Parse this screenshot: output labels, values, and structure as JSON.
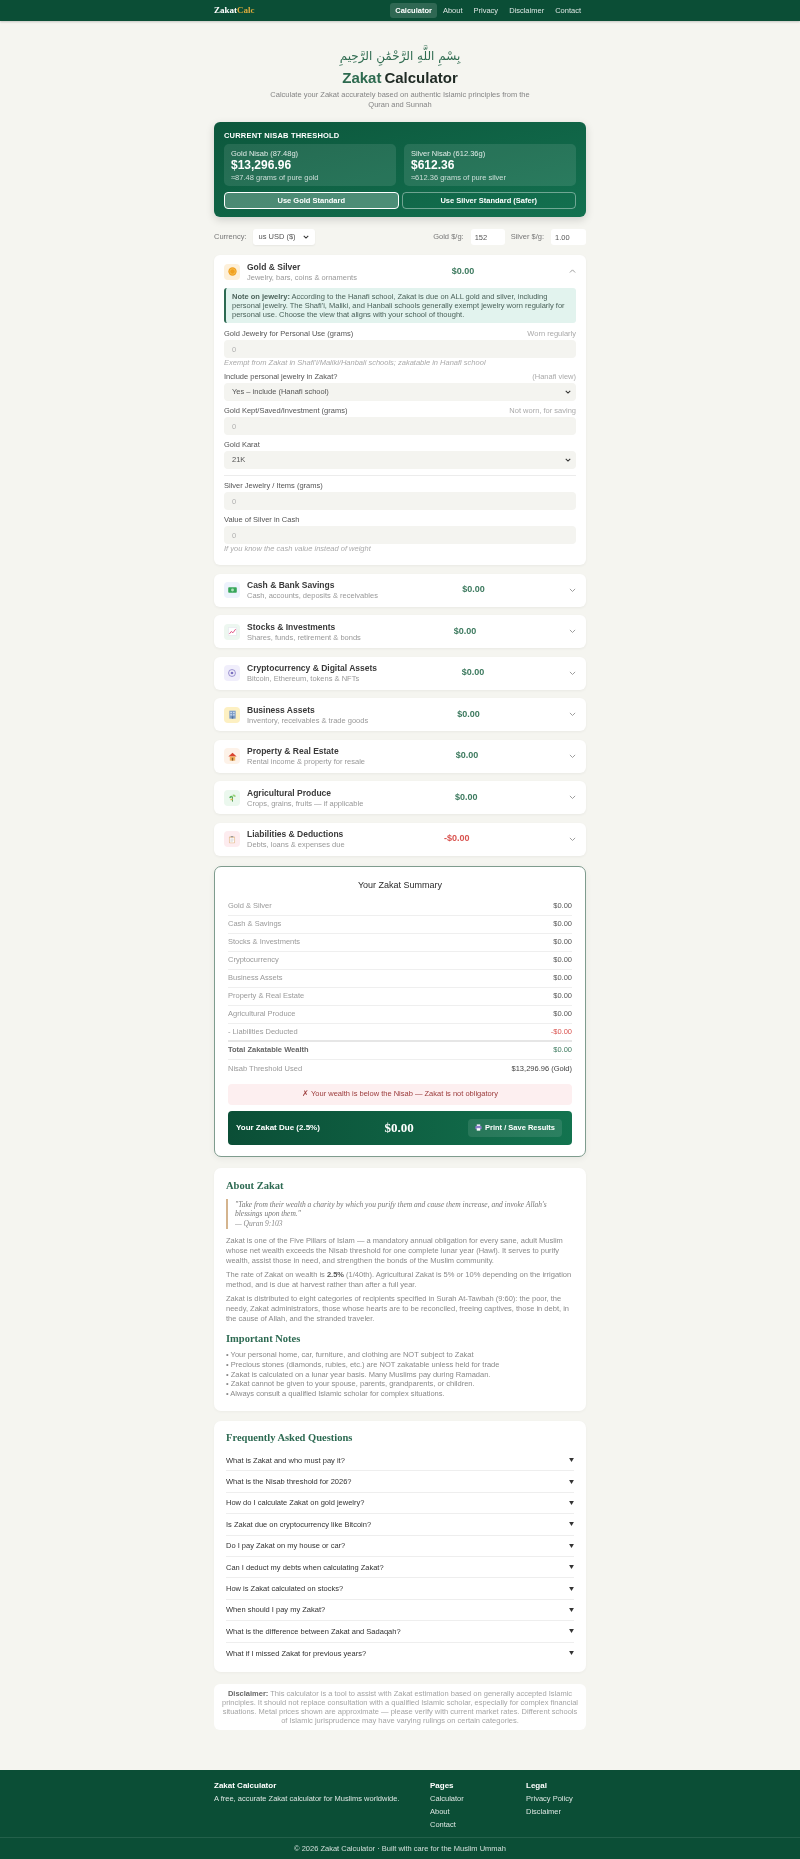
{
  "nav": {
    "logo": {
      "first": "Zakat",
      "second": "Calc"
    },
    "items": [
      {
        "label": "Calculator",
        "selected": true
      },
      {
        "label": "About",
        "selected": false
      },
      {
        "label": "Privacy",
        "selected": false
      },
      {
        "label": "Disclaimer",
        "selected": false
      },
      {
        "label": "Contact",
        "selected": false
      }
    ]
  },
  "header": {
    "bismillah": "بِسْمِ اللَّهِ الرَّحْمَٰنِ الرَّحِيمِ",
    "title_accent": "Zakat",
    "title_rest": "Calculator",
    "subtitle": "Calculate your Zakat accurately based on authentic Islamic principles from the Quran and Sunnah"
  },
  "nisab": {
    "title": "CURRENT NISAB THRESHOLD",
    "standards": [
      {
        "label": "Gold Nisab (87.48g)",
        "value": "$13,296.96",
        "note": "≈87.48 grams of pure gold"
      },
      {
        "label": "Silver Nisab (612.36g)",
        "value": "$612.36",
        "note": "≈612.36 grams of pure silver"
      }
    ],
    "buttons": [
      {
        "label": "Use Gold Standard",
        "selected": true
      },
      {
        "label": "Use Silver Standard (Safer)",
        "selected": false
      }
    ]
  },
  "prices": {
    "currency_label": "Currency:",
    "currency": "us USD ($)",
    "gold_label": "Gold $/g:",
    "gold_value": "152",
    "silver_label": "Silver $/g:",
    "silver_value": "1.00"
  },
  "categories": [
    {
      "title": "Gold & Silver",
      "subtitle": "Jewelry, bars, coins & ornaments",
      "value": "$0.00",
      "kind": "asset",
      "expanded": true,
      "note": "**Note on jewelry:** According to the Hanafi school, Zakat is due on ALL gold and silver, including personal jewelry. The Shafi'i, Maliki, and Hanbali schools generally exempt jewelry worn regularly for personal use. Choose the view that aligns with your school of thought.",
      "sections": [
        {
          "fields": [
            {
              "kind": "number",
              "label": "Gold Jewelry for Personal Use (grams)",
              "tag": "Worn regularly",
              "placeholder": "0",
              "help": "Exempt from Zakat in Shafi'i/Maliki/Hanbali schools; zakatable in Hanafi school"
            },
            {
              "kind": "select",
              "label": "Include personal jewelry in Zakat?",
              "tag": "(Hanafi view)",
              "value": "Yes – include (Hanafi school)"
            },
            {
              "kind": "number",
              "label": "Gold Kept/Saved/Investment (grams)",
              "tag": "Not worn, for saving",
              "placeholder": "0"
            },
            {
              "kind": "select",
              "label": "Gold Karat",
              "value": "21K"
            }
          ]
        },
        {
          "fields": [
            {
              "kind": "number",
              "label": "Silver Jewelry / Items (grams)",
              "placeholder": "0"
            },
            {
              "kind": "number",
              "label": "Value of Silver in Cash",
              "placeholder": "0",
              "help": "If you know the cash value instead of weight"
            }
          ]
        }
      ]
    },
    {
      "title": "Cash & Bank Savings",
      "subtitle": "Cash, accounts, deposits & receivables",
      "value": "$0.00",
      "kind": "asset",
      "expanded": false
    },
    {
      "title": "Stocks & Investments",
      "subtitle": "Shares, funds, retirement & bonds",
      "value": "$0.00",
      "kind": "asset",
      "expanded": false
    },
    {
      "title": "Cryptocurrency & Digital Assets",
      "subtitle": "Bitcoin, Ethereum, tokens & NFTs",
      "value": "$0.00",
      "kind": "asset",
      "expanded": false
    },
    {
      "title": "Business Assets",
      "subtitle": "Inventory, receivables & trade goods",
      "value": "$0.00",
      "kind": "asset",
      "expanded": false
    },
    {
      "title": "Property & Real Estate",
      "subtitle": "Rental income & property for resale",
      "value": "$0.00",
      "kind": "asset",
      "expanded": false
    },
    {
      "title": "Agricultural Produce",
      "subtitle": "Crops, grains, fruits — if applicable",
      "value": "$0.00",
      "kind": "asset",
      "expanded": false
    },
    {
      "title": "Liabilities & Deductions",
      "subtitle": "Debts, loans & expenses due",
      "value": "-$0.00",
      "kind": "deduction",
      "expanded": false
    }
  ],
  "summary": {
    "title": "Your Zakat Summary",
    "rows": [
      {
        "kind": "item",
        "label": "Gold & Silver",
        "value": "$0.00"
      },
      {
        "kind": "item",
        "label": "Cash & Savings",
        "value": "$0.00"
      },
      {
        "kind": "item",
        "label": "Stocks & Investments",
        "value": "$0.00"
      },
      {
        "kind": "item",
        "label": "Cryptocurrency",
        "value": "$0.00"
      },
      {
        "kind": "item",
        "label": "Business Assets",
        "value": "$0.00"
      },
      {
        "kind": "item",
        "label": "Property & Real Estate",
        "value": "$0.00"
      },
      {
        "kind": "item",
        "label": "Agricultural Produce",
        "value": "$0.00"
      },
      {
        "kind": "deduction",
        "label": "- Liabilities Deducted",
        "value": "-$0.00"
      },
      {
        "kind": "total",
        "label": "Total Zakatable Wealth",
        "value": "$0.00"
      },
      {
        "kind": "nisab",
        "label": "Nisab Threshold Used",
        "value": "$13,296.96 (Gold)"
      }
    ],
    "status": {
      "kind": "below",
      "text": "✗ Your wealth is below the Nisab — Zakat is not obligatory"
    },
    "due": {
      "label": "Your Zakat Due (2.5%)",
      "value": "$0.00",
      "button": "Print / Save Results"
    }
  },
  "about": {
    "title": "About Zakat",
    "quote": "\"Take from their wealth a charity by which you purify them and cause them increase, and invoke Allah's blessings upon them.\"",
    "quote_source": "— Quran 9:103",
    "paragraphs": [
      "Zakat is one of the Five Pillars of Islam — a mandatory annual obligation for every sane, adult Muslim whose net wealth exceeds the Nisab threshold for one complete lunar year (Hawl). It serves to purify wealth, assist those in need, and strengthen the bonds of the Muslim community.",
      "The rate of Zakat on wealth is **2.5%** (1/40th). Agricultural Zakat is 5% or 10% depending on the irrigation method, and is due at harvest rather than after a full year.",
      "Zakat is distributed to eight categories of recipients specified in Surah At-Tawbah (9:60): the poor, the needy, Zakat administrators, those whose hearts are to be reconciled, freeing captives, those in debt, in the cause of Allah, and the stranded traveler."
    ],
    "notes_title": "Important Notes",
    "notes": [
      "• Your personal home, car, furniture, and clothing are NOT subject to Zakat",
      "• Precious stones (diamonds, rubies, etc.) are NOT zakatable unless held for trade",
      "• Zakat is calculated on a lunar year basis. Many Muslims pay during Ramadan.",
      "• Zakat cannot be given to your spouse, parents, grandparents, or children.",
      "• Always consult a qualified Islamic scholar for complex situations."
    ]
  },
  "faq": {
    "title": "Frequently Asked Questions",
    "items": [
      {
        "question": "What is Zakat and who must pay it?",
        "expanded": false
      },
      {
        "question": "What is the Nisab threshold for 2026?",
        "expanded": false
      },
      {
        "question": "How do I calculate Zakat on gold jewelry?",
        "expanded": false
      },
      {
        "question": "Is Zakat due on cryptocurrency like Bitcoin?",
        "expanded": false
      },
      {
        "question": "Do I pay Zakat on my house or car?",
        "expanded": false
      },
      {
        "question": "Can I deduct my debts when calculating Zakat?",
        "expanded": false
      },
      {
        "question": "How is Zakat calculated on stocks?",
        "expanded": false
      },
      {
        "question": "When should I pay my Zakat?",
        "expanded": false
      },
      {
        "question": "What is the difference between Zakat and Sadaqah?",
        "expanded": false
      },
      {
        "question": "What if I missed Zakat for previous years?",
        "expanded": false
      }
    ]
  },
  "disclaimer": "**Disclaimer:** This calculator is a tool to assist with Zakat estimation based on generally accepted Islamic principles. It should not replace consultation with a qualified Islamic scholar, especially for complex financial situations. Metal prices shown are approximate — please verify with current market rates. Different schools of Islamic jurisprudence may have varying rulings on certain categories.",
  "footer": {
    "brand": "Zakat Calculator",
    "tagline": "A free, accurate Zakat calculator for Muslims worldwide.",
    "columns": [
      {
        "title": "Pages",
        "links": [
          "Calculator",
          "About",
          "Contact"
        ]
      },
      {
        "title": "Legal",
        "links": [
          "Privacy Policy",
          "Disclaimer"
        ]
      }
    ],
    "copyright": "© 2026 Zakat Calculator · Built with care for the Muslim Ummah"
  }
}
